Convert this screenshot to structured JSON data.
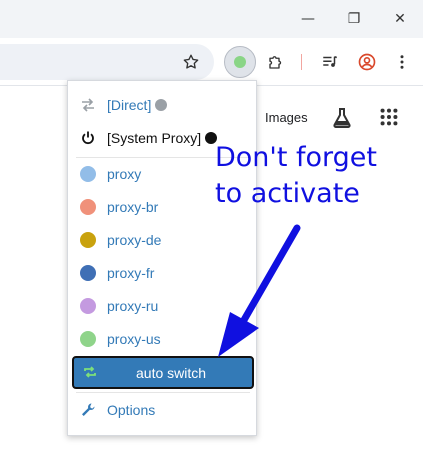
{
  "window_controls": {
    "minimize": "—",
    "maximize": "❐",
    "close": "✕"
  },
  "toolbar": {
    "icons": [
      "star-icon",
      "proxy-extension-icon",
      "extensions-puzzle-icon",
      "media-control-icon",
      "profile-icon",
      "menu-kebab-icon"
    ],
    "proxy_status_color": "#8ad586"
  },
  "page": {
    "images_link": "Images"
  },
  "menu": {
    "items": [
      {
        "label": "[Direct]",
        "icon": "direct-arrows-icon",
        "globe_color": "#9aa0a6"
      },
      {
        "label": "[System Proxy]",
        "icon": "power-icon",
        "globe_color": "#111111"
      },
      {
        "label": "proxy",
        "icon": "globe-icon",
        "globe_color": "#92bde8"
      },
      {
        "label": "proxy-br",
        "icon": "globe-icon",
        "globe_color": "#f0917a"
      },
      {
        "label": "proxy-de",
        "icon": "globe-icon",
        "globe_color": "#c9a20e"
      },
      {
        "label": "proxy-fr",
        "icon": "globe-icon",
        "globe_color": "#3f6fb5"
      },
      {
        "label": "proxy-ru",
        "icon": "globe-icon",
        "globe_color": "#c49ae0"
      },
      {
        "label": "proxy-us",
        "icon": "globe-icon",
        "globe_color": "#8fd48a"
      },
      {
        "label": "auto switch",
        "icon": "auto-switch-icon",
        "active": true
      },
      {
        "label": "Options",
        "icon": "wrench-icon"
      }
    ]
  },
  "annotation": {
    "text_line1": "Don't forget",
    "text_line2": "to activate",
    "color": "#1010e0"
  }
}
